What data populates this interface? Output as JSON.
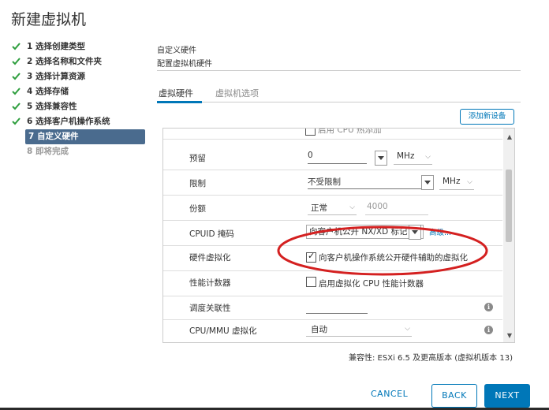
{
  "dialog": {
    "title": "新建虚拟机"
  },
  "steps": [
    {
      "label": "1 选择创建类型",
      "done": true
    },
    {
      "label": "2 选择名称和文件夹",
      "done": true
    },
    {
      "label": "3 选择计算资源",
      "done": true
    },
    {
      "label": "4 选择存储",
      "done": true
    },
    {
      "label": "5 选择兼容性",
      "done": true
    },
    {
      "label": "6 选择客户机操作系统",
      "done": true
    },
    {
      "label": "7 自定义硬件",
      "active": true
    },
    {
      "label": "8 即将完成",
      "future": true
    }
  ],
  "section": {
    "title": "自定义硬件",
    "subtitle": "配置虚拟机硬件"
  },
  "tabs": [
    {
      "label": "虚拟硬件",
      "selected": true
    },
    {
      "label": "虚拟机选项"
    }
  ],
  "add_device_label": "添加新设备",
  "hardware": {
    "cut_row": {
      "label": "启用 CPU 热添加"
    },
    "reservation": {
      "label": "预留",
      "value": "0",
      "unit": "MHz"
    },
    "limit": {
      "label": "限制",
      "value": "不受限制",
      "unit": "MHz"
    },
    "shares": {
      "label": "份额",
      "level": "正常",
      "value": "4000"
    },
    "cpuid": {
      "label": "CPUID 掩码",
      "value": "向客户机公开 NX/XD 标记",
      "advanced": "高级..."
    },
    "hw_virt": {
      "label": "硬件虚拟化",
      "checkbox": "向客户机操作系统公开硬件辅助的虚拟化",
      "checked": true
    },
    "perf_counters": {
      "label": "性能计数器",
      "checkbox": "启用虚拟化 CPU 性能计数器",
      "checked": false
    },
    "sched_affinity": {
      "label": "调度关联性",
      "value": ""
    },
    "cpu_mmu": {
      "label": "CPU/MMU 虚拟化",
      "value": "自动"
    }
  },
  "compatibility": "兼容性: ESXi 6.5 及更高版本 (虚拟机版本 13)",
  "buttons": {
    "cancel": "CANCEL",
    "back": "BACK",
    "next": "NEXT"
  },
  "colors": {
    "accent": "#0077b8",
    "active_step": "#4a6b8e",
    "check": "#2e9e3e",
    "annotation": "#d42020"
  }
}
